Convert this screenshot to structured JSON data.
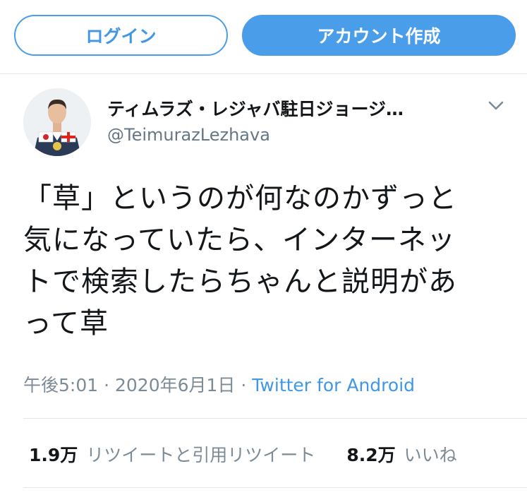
{
  "header": {
    "login_label": "ログイン",
    "signup_label": "アカウント作成"
  },
  "tweet": {
    "display_name": "ティムラズ・レジャバ駐日ジョージ…",
    "handle": "@TeimurazLezhava",
    "text_lines": [
      "「草」というのが何なのかずっと",
      "気になっていたら、インターネッ",
      "トで検索したらちゃんと説明があ",
      "って草"
    ],
    "time": "午後5:01",
    "date": "2020年6月1日",
    "source": "Twitter for Android"
  },
  "stats": {
    "retweets_count": "1.9万",
    "retweets_label": "リツイートと引用リツイート",
    "likes_count": "8.2万",
    "likes_label": "いいね"
  },
  "colors": {
    "accent": "#4a9de8",
    "text_primary": "#14171a",
    "text_secondary": "#7d8b96",
    "divider": "#e1e8ed"
  }
}
